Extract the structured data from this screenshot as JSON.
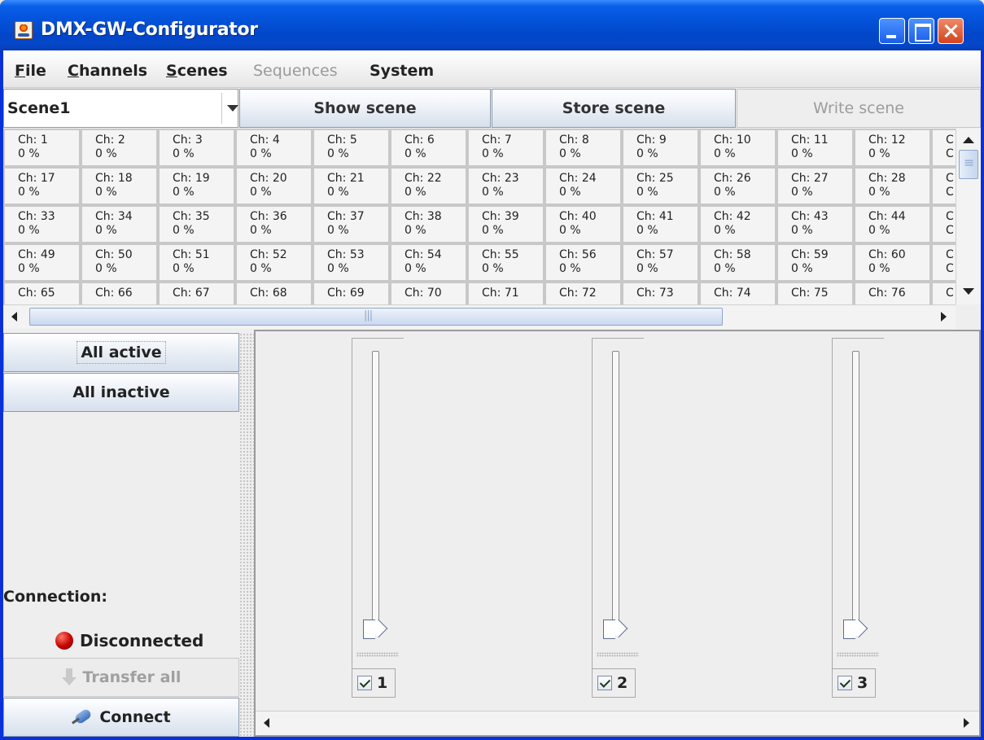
{
  "window": {
    "title": "DMX-GW-Configurator",
    "icon": "java-cup-icon"
  },
  "menu": {
    "items": [
      {
        "label": "File",
        "mnemonic": "F",
        "enabled": true
      },
      {
        "label": "Channels",
        "mnemonic": "C",
        "enabled": true
      },
      {
        "label": "Scenes",
        "mnemonic": "S",
        "enabled": true
      },
      {
        "label": "Sequences",
        "enabled": false
      },
      {
        "label": "System",
        "enabled": true
      }
    ]
  },
  "toolbar": {
    "scene_select": {
      "value": "Scene1"
    },
    "show_scene": "Show scene",
    "store_scene": "Store scene",
    "write_scene": "Write scene"
  },
  "channels": {
    "rows": [
      {
        "cells": [
          {
            "ch": "Ch: 1",
            "v": "0 %"
          },
          {
            "ch": "Ch: 2",
            "v": "0 %"
          },
          {
            "ch": "Ch: 3",
            "v": "0 %"
          },
          {
            "ch": "Ch: 4",
            "v": "0 %"
          },
          {
            "ch": "Ch: 5",
            "v": "0 %"
          },
          {
            "ch": "Ch: 6",
            "v": "0 %"
          },
          {
            "ch": "Ch: 7",
            "v": "0 %"
          },
          {
            "ch": "Ch: 8",
            "v": "0 %"
          },
          {
            "ch": "Ch: 9",
            "v": "0 %"
          },
          {
            "ch": "Ch: 10",
            "v": "0 %"
          },
          {
            "ch": "Ch: 11",
            "v": "0 %"
          },
          {
            "ch": "Ch: 12",
            "v": "0 %"
          },
          {
            "ch": "C",
            "v": "C"
          }
        ]
      },
      {
        "cells": [
          {
            "ch": "Ch: 17",
            "v": "0 %"
          },
          {
            "ch": "Ch: 18",
            "v": "0 %"
          },
          {
            "ch": "Ch: 19",
            "v": "0 %"
          },
          {
            "ch": "Ch: 20",
            "v": "0 %"
          },
          {
            "ch": "Ch: 21",
            "v": "0 %"
          },
          {
            "ch": "Ch: 22",
            "v": "0 %"
          },
          {
            "ch": "Ch: 23",
            "v": "0 %"
          },
          {
            "ch": "Ch: 24",
            "v": "0 %"
          },
          {
            "ch": "Ch: 25",
            "v": "0 %"
          },
          {
            "ch": "Ch: 26",
            "v": "0 %"
          },
          {
            "ch": "Ch: 27",
            "v": "0 %"
          },
          {
            "ch": "Ch: 28",
            "v": "0 %"
          },
          {
            "ch": "C",
            "v": "C"
          }
        ]
      },
      {
        "cells": [
          {
            "ch": "Ch: 33",
            "v": "0 %"
          },
          {
            "ch": "Ch: 34",
            "v": "0 %"
          },
          {
            "ch": "Ch: 35",
            "v": "0 %"
          },
          {
            "ch": "Ch: 36",
            "v": "0 %"
          },
          {
            "ch": "Ch: 37",
            "v": "0 %"
          },
          {
            "ch": "Ch: 38",
            "v": "0 %"
          },
          {
            "ch": "Ch: 39",
            "v": "0 %"
          },
          {
            "ch": "Ch: 40",
            "v": "0 %"
          },
          {
            "ch": "Ch: 41",
            "v": "0 %"
          },
          {
            "ch": "Ch: 42",
            "v": "0 %"
          },
          {
            "ch": "Ch: 43",
            "v": "0 %"
          },
          {
            "ch": "Ch: 44",
            "v": "0 %"
          },
          {
            "ch": "C",
            "v": "C"
          }
        ]
      },
      {
        "cells": [
          {
            "ch": "Ch: 49",
            "v": "0 %"
          },
          {
            "ch": "Ch: 50",
            "v": "0 %"
          },
          {
            "ch": "Ch: 51",
            "v": "0 %"
          },
          {
            "ch": "Ch: 52",
            "v": "0 %"
          },
          {
            "ch": "Ch: 53",
            "v": "0 %"
          },
          {
            "ch": "Ch: 54",
            "v": "0 %"
          },
          {
            "ch": "Ch: 55",
            "v": "0 %"
          },
          {
            "ch": "Ch: 56",
            "v": "0 %"
          },
          {
            "ch": "Ch: 57",
            "v": "0 %"
          },
          {
            "ch": "Ch: 58",
            "v": "0 %"
          },
          {
            "ch": "Ch: 59",
            "v": "0 %"
          },
          {
            "ch": "Ch: 60",
            "v": "0 %"
          },
          {
            "ch": "C",
            "v": "C"
          }
        ]
      },
      {
        "cells": [
          {
            "ch": "Ch: 65",
            "v": ""
          },
          {
            "ch": "Ch: 66",
            "v": ""
          },
          {
            "ch": "Ch: 67",
            "v": ""
          },
          {
            "ch": "Ch: 68",
            "v": ""
          },
          {
            "ch": "Ch: 69",
            "v": ""
          },
          {
            "ch": "Ch: 70",
            "v": ""
          },
          {
            "ch": "Ch: 71",
            "v": ""
          },
          {
            "ch": "Ch: 72",
            "v": ""
          },
          {
            "ch": "Ch: 73",
            "v": ""
          },
          {
            "ch": "Ch: 74",
            "v": ""
          },
          {
            "ch": "Ch: 75",
            "v": ""
          },
          {
            "ch": "Ch: 76",
            "v": ""
          },
          {
            "ch": "C",
            "v": ""
          }
        ]
      }
    ]
  },
  "left_panel": {
    "all_active": "All active",
    "all_inactive": "All inactive",
    "connection_label": "Connection:",
    "connection_status": "Disconnected",
    "status_color": "#c40000",
    "transfer_all": "Transfer all",
    "connect": "Connect"
  },
  "sliders": [
    {
      "label": "1",
      "checked": true,
      "value_percent": 0
    },
    {
      "label": "2",
      "checked": true,
      "value_percent": 0
    },
    {
      "label": "3",
      "checked": true,
      "value_percent": 0
    }
  ]
}
